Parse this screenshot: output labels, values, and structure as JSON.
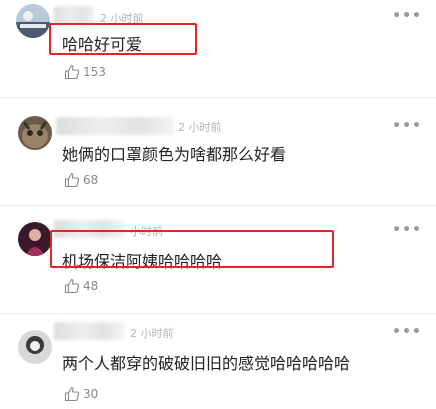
{
  "comments": [
    {
      "time": "2 小时前",
      "text": "哈哈好可爱",
      "likes": "153",
      "avatar_icon": "avatar-icon"
    },
    {
      "time": "2 小时前",
      "text": "她俩的口罩颜色为啥都那么好看",
      "likes": "68",
      "avatar_icon": "avatar-icon"
    },
    {
      "time": "小时前",
      "text": "机场保洁阿姨哈哈哈哈",
      "likes": "48",
      "avatar_icon": "avatar-icon"
    },
    {
      "time": "2 小时前",
      "text": "两个人都穿的破破旧旧的感觉哈哈哈哈哈",
      "likes": "30",
      "avatar_icon": "avatar-icon"
    }
  ],
  "more_icon": "more-dots-icon",
  "like_icon": "thumbs-up-icon",
  "colors": {
    "highlight": "#e32525",
    "text": "#222222",
    "meta": "#b4b4b4"
  }
}
